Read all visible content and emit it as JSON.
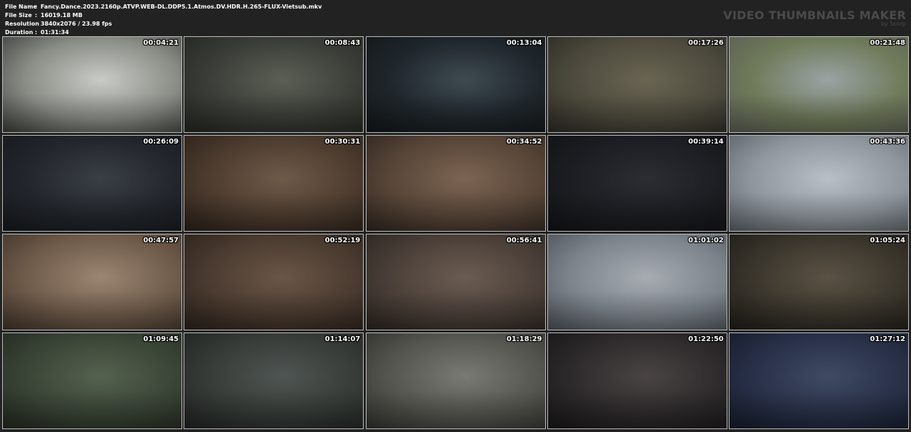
{
  "info": {
    "file_name_label": "File Name",
    "file_name": "Fancy.Dance.2023.2160p.ATVP.WEB-DL.DDP5.1.Atmos.DV.HDR.H.265-FLUX-Vietsub.mkv",
    "file_size_label": "File Size",
    "file_size": "16019.18 MB",
    "resolution_label": "Resolution",
    "resolution": "3840x2076 / 23.98 fps",
    "duration_label": "Duration",
    "duration": "01:31:34",
    "separator": ":"
  },
  "brand": {
    "title": "VIDEO THUMBNAILS MAKER",
    "subtitle": "by Scorp"
  },
  "thumbnails": [
    {
      "timestamp": "00:04:21",
      "colors": [
        "#c9cbc6",
        "#8a8d86",
        "#3a3c38"
      ]
    },
    {
      "timestamp": "00:08:43",
      "colors": [
        "#5b5f55",
        "#3a3d37",
        "#23251f"
      ]
    },
    {
      "timestamp": "00:13:04",
      "colors": [
        "#3e4a52",
        "#1f262b",
        "#121618"
      ]
    },
    {
      "timestamp": "00:17:26",
      "colors": [
        "#6a6552",
        "#4d4a3d",
        "#2b2a24"
      ]
    },
    {
      "timestamp": "00:21:48",
      "colors": [
        "#9aa3a4",
        "#6f7a5a",
        "#5a5d53"
      ]
    },
    {
      "timestamp": "00:26:09",
      "colors": [
        "#3a3e45",
        "#22262c",
        "#15181c"
      ]
    },
    {
      "timestamp": "00:30:31",
      "colors": [
        "#6f5a49",
        "#4c3b2e",
        "#2a2019"
      ]
    },
    {
      "timestamp": "00:34:52",
      "colors": [
        "#7c6452",
        "#574538",
        "#2f251e"
      ]
    },
    {
      "timestamp": "00:39:14",
      "colors": [
        "#2b2d33",
        "#1c1d22",
        "#111215"
      ]
    },
    {
      "timestamp": "00:43:36",
      "colors": [
        "#b9bfc6",
        "#8f969d",
        "#5a6066"
      ]
    },
    {
      "timestamp": "00:47:57",
      "colors": [
        "#9b8573",
        "#6f5b4a",
        "#3f3329"
      ]
    },
    {
      "timestamp": "00:52:19",
      "colors": [
        "#6a5647",
        "#4a3a2f",
        "#2a211b"
      ]
    },
    {
      "timestamp": "00:56:41",
      "colors": [
        "#6b5c52",
        "#4a3f38",
        "#2a241f"
      ]
    },
    {
      "timestamp": "01:01:02",
      "colors": [
        "#a7acb2",
        "#7d848c",
        "#4c5157"
      ]
    },
    {
      "timestamp": "01:05:24",
      "colors": [
        "#5a5244",
        "#3a352c",
        "#1e1c18"
      ]
    },
    {
      "timestamp": "01:09:45",
      "colors": [
        "#55624f",
        "#3a4436",
        "#22281f"
      ]
    },
    {
      "timestamp": "01:14:07",
      "colors": [
        "#4f5552",
        "#363b38",
        "#1f2220"
      ]
    },
    {
      "timestamp": "01:18:29",
      "colors": [
        "#7a7a74",
        "#55554f",
        "#30302c"
      ]
    },
    {
      "timestamp": "01:22:50",
      "colors": [
        "#4a4444",
        "#2d2a2b",
        "#171516"
      ]
    },
    {
      "timestamp": "01:27:12",
      "colors": [
        "#3f4a63",
        "#283048",
        "#151a29"
      ]
    }
  ]
}
